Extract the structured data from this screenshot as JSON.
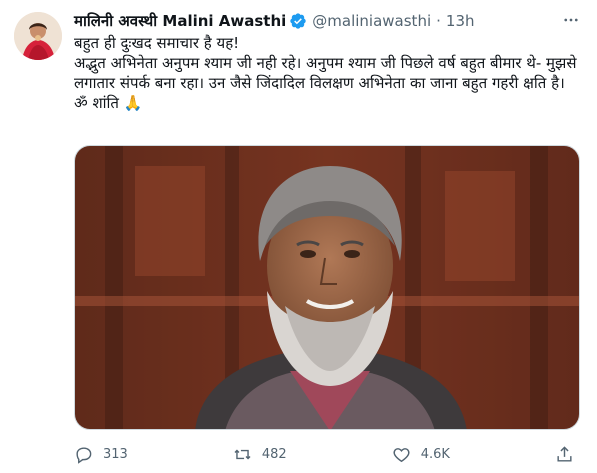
{
  "tweet": {
    "display_name_hi": "मालिनी अवस्थी",
    "display_name_en": "Malini Awasthi",
    "handle": "@maliniawasthi",
    "separator": "·",
    "time": "13h",
    "text_lines": [
      "बहुत ही दुःखद समाचार है यह!",
      "अद्भुत अभिनेता अनुपम श्याम जी नही रहे। अनुपम श्याम जी पिछले वर्ष बहुत बीमार थे- मुझसे लगातार संपर्क बना रहा। उन जैसे जिंदादिल विलक्षण अभिनेता का जाना बहुत गहरी क्षति है।",
      "ॐ शांति 🙏"
    ],
    "counts": {
      "reply": "313",
      "retweet": "482",
      "like": "4.6K"
    }
  },
  "icons": {
    "verified": "verified-badge-icon",
    "more": "more-options-icon",
    "reply": "reply-icon",
    "retweet": "retweet-icon",
    "like": "heart-icon",
    "share": "share-icon"
  },
  "colors": {
    "verified": "#1d9bf0",
    "text": "#0f1419",
    "secondary": "#536471"
  }
}
